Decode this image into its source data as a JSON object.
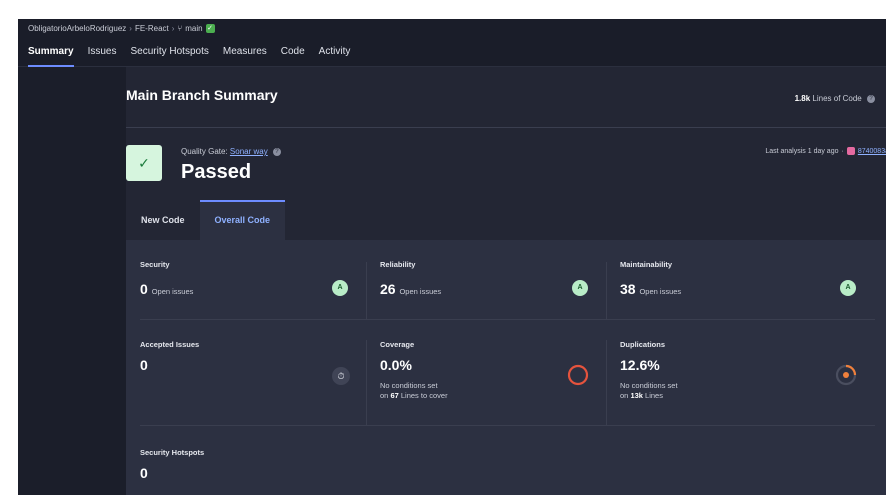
{
  "breadcrumb": {
    "org": "ObligatorioArbeloRodriguez",
    "project": "FE-React",
    "branch": "main"
  },
  "nav": {
    "tabs": [
      "Summary",
      "Issues",
      "Security Hotspots",
      "Measures",
      "Code",
      "Activity"
    ],
    "active": "Summary"
  },
  "summary": {
    "title": "Main Branch Summary",
    "lines_value": "1.8k",
    "lines_label": "Lines of Code"
  },
  "quality_gate": {
    "label": "Quality Gate:",
    "gate_name": "Sonar way",
    "status": "Passed",
    "last_analysis": "Last analysis 1 day ago",
    "commit": "8740083a"
  },
  "code_tabs": [
    "New Code",
    "Overall Code"
  ],
  "metrics": {
    "security": {
      "title": "Security",
      "value": "0",
      "unit": "Open issues",
      "rating": "A"
    },
    "reliability": {
      "title": "Reliability",
      "value": "26",
      "unit": "Open issues",
      "rating": "A"
    },
    "maintainability": {
      "title": "Maintainability",
      "value": "38",
      "unit": "Open issues",
      "rating": "A"
    },
    "accepted": {
      "title": "Accepted Issues",
      "value": "0"
    },
    "coverage": {
      "title": "Coverage",
      "value": "0.0%",
      "sub1": "No conditions set",
      "sub2_pre": "on",
      "sub2_num": "67",
      "sub2_post": "Lines to cover"
    },
    "duplications": {
      "title": "Duplications",
      "value": "12.6%",
      "sub1": "No conditions set",
      "sub2_pre": "on",
      "sub2_num": "13k",
      "sub2_post": "Lines"
    },
    "hotspots": {
      "title": "Security Hotspots",
      "value": "0"
    }
  },
  "colors": {
    "accent": "#6d8cff",
    "passed": "#4caf50",
    "coverage_ring": "#e5533d",
    "duplication_ring": "#f0803c"
  }
}
